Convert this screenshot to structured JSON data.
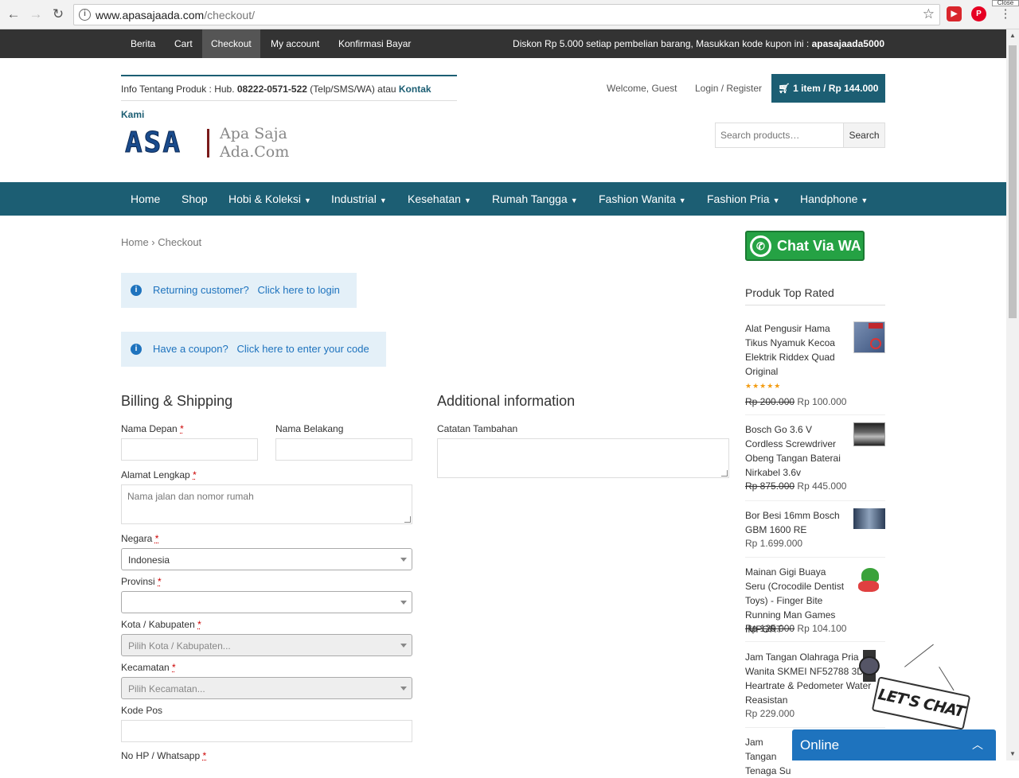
{
  "browser": {
    "url_host": "www.apasajaada.com",
    "url_path": "/checkout/",
    "close_label": "Close"
  },
  "topbar": {
    "links": [
      "Berita",
      "Cart",
      "Checkout",
      "My account",
      "Konfirmasi Bayar"
    ],
    "active": "Checkout",
    "promo_text": "Diskon Rp 5.000 setiap pembelian barang, Masukkan kode kupon ini : ",
    "promo_code": "apasajaada5000"
  },
  "header": {
    "info_prefix": "Info Tentang Produk : Hub. ",
    "phone": "08222-0571-522",
    "info_mid": " (Telp/SMS/WA) atau ",
    "contact": "Kontak Kami",
    "welcome": "Welcome, Guest",
    "login": "Login / Register",
    "cart": "1 item / Rp 144.000",
    "logo_short": "ASA",
    "logo_line1": "Apa Saja",
    "logo_line2": "Ada.Com",
    "search_placeholder": "Search products…",
    "search_button": "Search"
  },
  "mainnav": {
    "items": [
      {
        "label": "Home",
        "dropdown": false
      },
      {
        "label": "Shop",
        "dropdown": false
      },
      {
        "label": "Hobi & Koleksi",
        "dropdown": true
      },
      {
        "label": "Industrial",
        "dropdown": true
      },
      {
        "label": "Kesehatan",
        "dropdown": true
      },
      {
        "label": "Rumah Tangga",
        "dropdown": true
      },
      {
        "label": "Fashion Wanita",
        "dropdown": true
      },
      {
        "label": "Fashion Pria",
        "dropdown": true
      },
      {
        "label": "Handphone",
        "dropdown": true
      }
    ]
  },
  "breadcrumb": {
    "home": "Home",
    "sep": " › ",
    "current": "Checkout"
  },
  "notices": {
    "returning_q": "Returning customer?",
    "returning_link": "Click here to login",
    "coupon_q": "Have a coupon?",
    "coupon_link": "Click here to enter your code"
  },
  "billing": {
    "title": "Billing & Shipping",
    "first_name": "Nama Depan",
    "last_name": "Nama Belakang",
    "address": "Alamat Lengkap",
    "address_placeholder": "Nama jalan dan nomor rumah",
    "country": "Negara",
    "country_value": "Indonesia",
    "province": "Provinsi",
    "province_value": "",
    "city": "Kota / Kabupaten",
    "city_placeholder": "Pilih Kota / Kabupaten...",
    "district": "Kecamatan",
    "district_placeholder": "Pilih Kecamatan...",
    "postcode": "Kode Pos",
    "phone": "No HP / Whatsapp",
    "required_mark": "*"
  },
  "additional": {
    "title": "Additional information",
    "notes": "Catatan Tambahan"
  },
  "sidebar": {
    "wa_button": "Chat Via WA",
    "top_rated_title": "Produk Top Rated",
    "products": [
      {
        "name": "Alat Pengusir Hama Tikus Nyamuk Kecoa Elektrik Riddex Quad Original",
        "old_price": "Rp 200.000",
        "price": "Rp 100.000",
        "rating": 5,
        "stars": "★★★★★"
      },
      {
        "name": "Bosch Go 3.6 V Cordless Screwdriver Obeng Tangan Baterai Nirkabel 3.6v",
        "old_price": "Rp 875.000",
        "price": "Rp 445.000"
      },
      {
        "name": "Bor Besi 16mm Bosch GBM 1600 RE",
        "old_price": "",
        "price": "Rp 1.699.000"
      },
      {
        "name": "Mainan Gigi Buaya Seru (Crocodile Dentist Toys) - Finger Bite Running Man Games IMPORT",
        "old_price": "Rp 125.000",
        "price": "Rp 104.100"
      },
      {
        "name": "Jam Tangan Olahraga Pria Wanita SKMEI NF52788 3D Heartrate & Pedometer Water Reasistan",
        "old_price": "",
        "price": "Rp 229.000"
      },
      {
        "name": "Jam Tangan Tenaga Su",
        "old_price": "",
        "price": ""
      }
    ]
  },
  "chat": {
    "sign": "LET'S CHAT",
    "status": "Online"
  },
  "colors": {
    "brand": "#1c5e73",
    "topbar": "#333333",
    "link": "#1e73be",
    "wa": "#25a244"
  }
}
